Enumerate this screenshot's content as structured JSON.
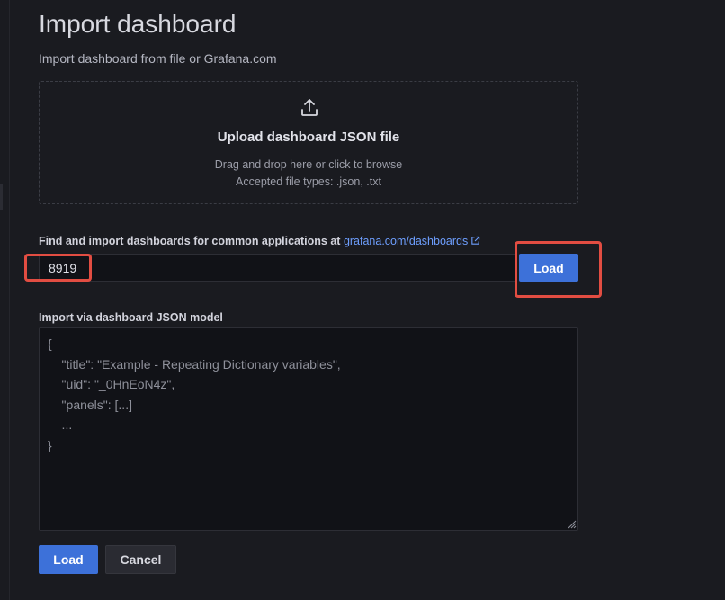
{
  "page": {
    "title": "Import dashboard",
    "subtitle": "Import dashboard from file or Grafana.com"
  },
  "upload": {
    "icon": "upload-icon",
    "title": "Upload dashboard JSON file",
    "hint": "Drag and drop here or click to browse",
    "accepted": "Accepted file types: .json, .txt"
  },
  "grafana_import": {
    "label": "Find and import dashboards for common applications at",
    "link_text": "grafana.com/dashboards",
    "link_icon": "external-link-icon",
    "input_value": "8919",
    "load_label": "Load"
  },
  "json_model": {
    "label": "Import via dashboard JSON model",
    "placeholder_lines": [
      "{",
      "    \"title\": \"Example - Repeating Dictionary variables\",",
      "    \"uid\": \"_0HnEoN4z\",",
      "    \"panels\": [...]",
      "    ...",
      "}"
    ]
  },
  "actions": {
    "load_label": "Load",
    "cancel_label": "Cancel"
  },
  "colors": {
    "background": "#1a1b20",
    "primary": "#3d71d9",
    "link": "#6e9fff",
    "highlight": "#e24d42"
  }
}
